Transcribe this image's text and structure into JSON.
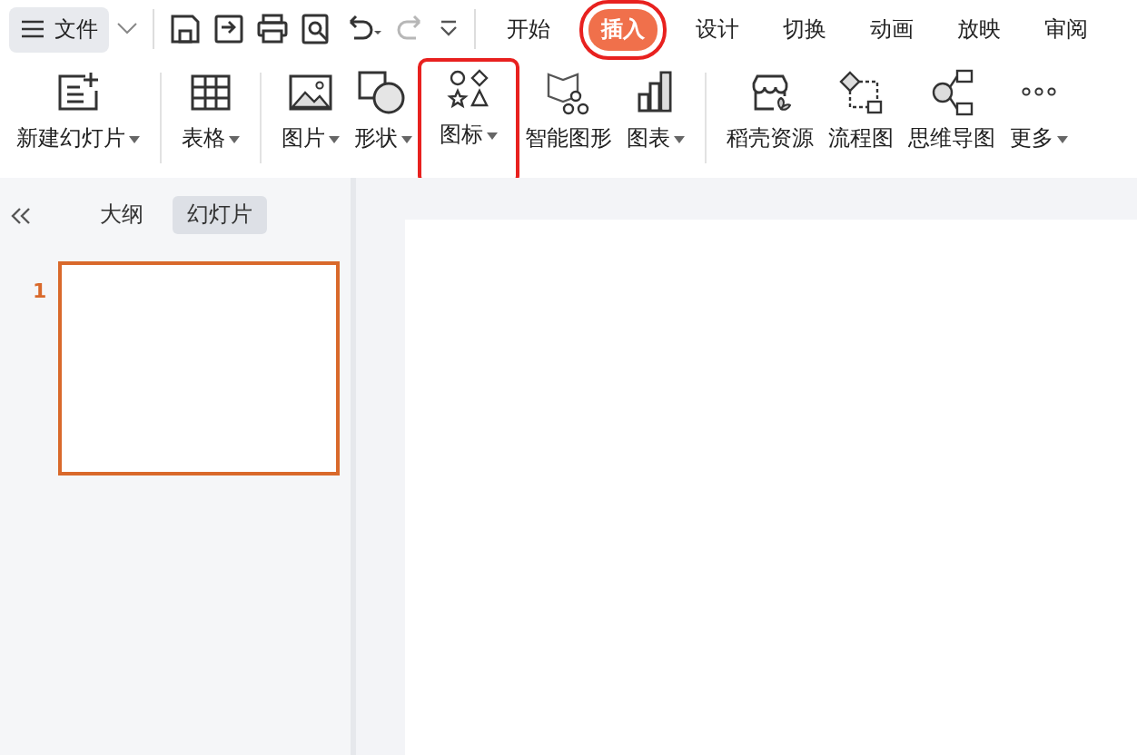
{
  "file_menu": {
    "label": "文件"
  },
  "quick_access": [
    {
      "kind": "save",
      "disabled": false
    },
    {
      "kind": "export",
      "disabled": false
    },
    {
      "kind": "print",
      "disabled": false
    },
    {
      "kind": "preview",
      "disabled": false
    },
    {
      "kind": "undo",
      "disabled": false
    },
    {
      "kind": "redo",
      "disabled": true
    },
    {
      "kind": "more",
      "disabled": false
    }
  ],
  "tabs": [
    {
      "label": "开始",
      "selected": false,
      "highlighted": false
    },
    {
      "label": "插入",
      "selected": true,
      "highlighted": true
    },
    {
      "label": "设计",
      "selected": false,
      "highlighted": false
    },
    {
      "label": "切换",
      "selected": false,
      "highlighted": false
    },
    {
      "label": "动画",
      "selected": false,
      "highlighted": false
    },
    {
      "label": "放映",
      "selected": false,
      "highlighted": false
    },
    {
      "label": "审阅",
      "selected": false,
      "highlighted": false
    }
  ],
  "ribbon_groups": [
    [
      {
        "kind": "new-slide",
        "label": "新建幻灯片",
        "dropdown": true,
        "highlighted": false
      }
    ],
    [
      {
        "kind": "table",
        "label": "表格",
        "dropdown": true,
        "highlighted": false
      }
    ],
    [
      {
        "kind": "picture",
        "label": "图片",
        "dropdown": true,
        "highlighted": false
      },
      {
        "kind": "shape",
        "label": "形状",
        "dropdown": true,
        "highlighted": false
      },
      {
        "kind": "icons",
        "label": "图标",
        "dropdown": true,
        "highlighted": true
      },
      {
        "kind": "smartart",
        "label": "智能图形",
        "dropdown": false,
        "highlighted": false
      },
      {
        "kind": "chart",
        "label": "图表",
        "dropdown": true,
        "highlighted": false
      }
    ],
    [
      {
        "kind": "store",
        "label": "稻壳资源",
        "dropdown": false,
        "highlighted": false
      },
      {
        "kind": "flow",
        "label": "流程图",
        "dropdown": false,
        "highlighted": false
      },
      {
        "kind": "mind",
        "label": "思维导图",
        "dropdown": false,
        "highlighted": false
      },
      {
        "kind": "more",
        "label": "更多",
        "dropdown": true,
        "highlighted": false
      }
    ]
  ],
  "pane_tabs": [
    {
      "label": "大纲",
      "selected": false
    },
    {
      "label": "幻灯片",
      "selected": true
    }
  ],
  "slides": [
    {
      "number": "1",
      "selected": true
    }
  ]
}
